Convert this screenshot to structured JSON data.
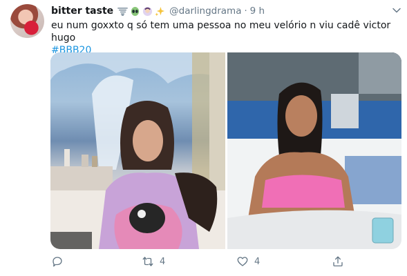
{
  "tweet": {
    "display_name": "bitter taste",
    "emojis": [
      "tornado-emoji",
      "alien-emoji",
      "woman-emoji",
      "sparkles-emoji"
    ],
    "handle": "@darlingdrama",
    "separator": "·",
    "time": "9 h",
    "text": "eu num goxxto q só tem uma pessoa no meu velório n viu cadê victor hugo",
    "hashtag": "#BBB20",
    "media": [
      "photo-woman-holding-doll",
      "photo-woman-pink-top"
    ],
    "actions": {
      "reply_count": "",
      "retweet_count": "4",
      "like_count": "4",
      "share_count": ""
    }
  },
  "colors": {
    "text": "#14171a",
    "secondary": "#657786",
    "link": "#1b95e0",
    "background": "#ffffff"
  }
}
